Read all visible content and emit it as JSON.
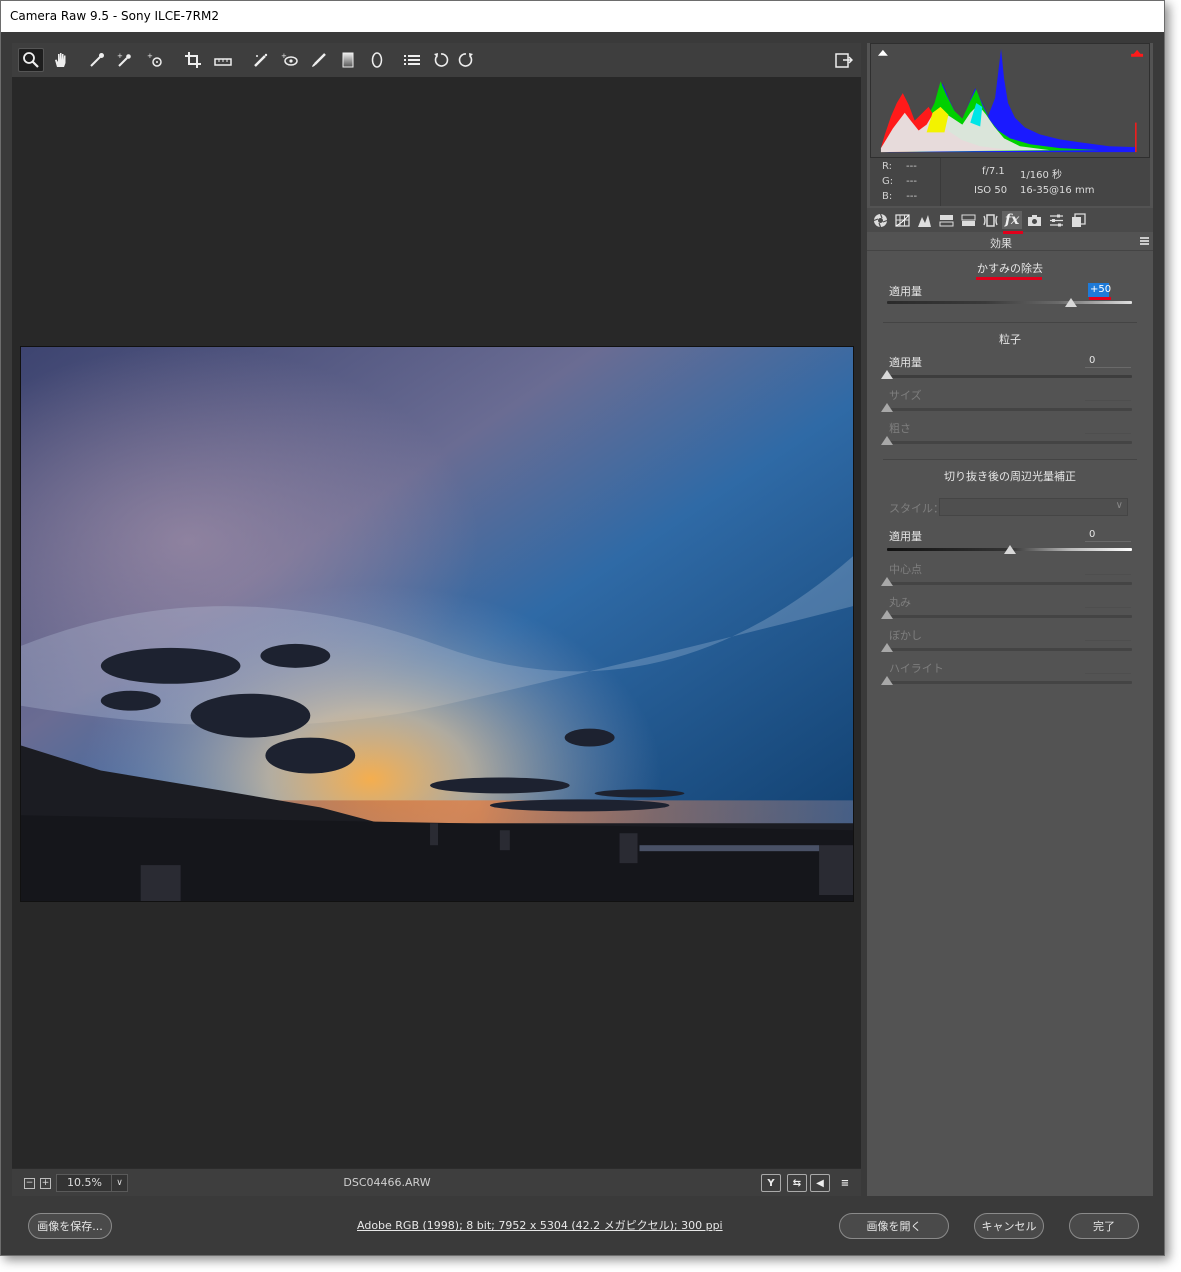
{
  "window": {
    "title": "Camera Raw 9.5  -  Sony ILCE-7RM2"
  },
  "toolbar": {
    "tools": [
      {
        "name": "zoom-tool",
        "icon": "magnifier-icon"
      },
      {
        "name": "hand-tool",
        "icon": "hand-icon"
      },
      {
        "name": "white-balance-tool",
        "icon": "eyedropper-icon"
      },
      {
        "name": "color-sampler-tool",
        "icon": "color-sampler-icon"
      },
      {
        "name": "targeted-adjustment-tool",
        "icon": "target-adjust-icon"
      },
      {
        "name": "crop-tool",
        "icon": "crop-icon"
      },
      {
        "name": "straighten-tool",
        "icon": "straighten-icon"
      },
      {
        "name": "spot-removal-tool",
        "icon": "spot-removal-icon"
      },
      {
        "name": "red-eye-tool",
        "icon": "red-eye-icon"
      },
      {
        "name": "adjustment-brush-tool",
        "icon": "brush-icon"
      },
      {
        "name": "graduated-filter-tool",
        "icon": "graduated-filter-icon"
      },
      {
        "name": "radial-filter-tool",
        "icon": "radial-filter-icon"
      },
      {
        "name": "preferences-button",
        "icon": "list-icon"
      },
      {
        "name": "rotate-left-button",
        "icon": "rotate-ccw-icon"
      },
      {
        "name": "rotate-right-button",
        "icon": "rotate-cw-icon"
      }
    ],
    "fullscreen_icon": "fullscreen-toggle-icon"
  },
  "status": {
    "zoom_minus": "−",
    "zoom_plus": "+",
    "zoom_value": "10.5%",
    "filename": "DSC04466.ARW",
    "view_buttons": [
      "Y",
      "⇆",
      "◀",
      "≡"
    ]
  },
  "info": {
    "r_label": "R:",
    "g_label": "G:",
    "b_label": "B:",
    "r_value": "---",
    "g_value": "---",
    "b_value": "---",
    "aperture": "f/7.1",
    "shutter": "1/160 秒",
    "iso": "ISO 50",
    "lens": "16-35@16 mm"
  },
  "panel": {
    "title": "効果",
    "fx_tab_label": "fx",
    "dehaze": {
      "title": "かすみの除去",
      "amount_label": "適用量",
      "amount_value": "+50",
      "amount_fraction": 0.75
    },
    "grain": {
      "title": "粒子",
      "amount_label": "適用量",
      "amount_value": "0",
      "size_label": "サイズ",
      "size_value": "",
      "roughness_label": "粗さ",
      "roughness_value": ""
    },
    "vignette": {
      "title": "切り抜き後の周辺光量補正",
      "style_label": "スタイル：",
      "style_value": "",
      "amount_label": "適用量",
      "amount_value": "0",
      "amount_fraction": 0.5,
      "midpoint_label": "中心点",
      "roundness_label": "丸み",
      "feather_label": "ぼかし",
      "highlights_label": "ハイライト"
    }
  },
  "footer": {
    "save_label": "画像を保存...",
    "workflow_text": "Adobe RGB (1998); 8 bit; 7952 x 5304 (42.2 メガピクセル); 300 ppi",
    "open_label": "画像を開く",
    "cancel_label": "キャンセル",
    "done_label": "完了"
  },
  "colors": {
    "highlight_red": "#e0001b",
    "selection_blue": "#1e7ad8"
  }
}
